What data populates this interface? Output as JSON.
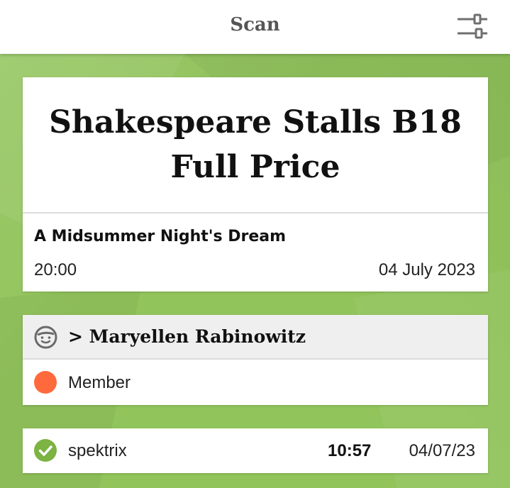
{
  "header": {
    "title": "Scan",
    "settings_icon": "sliders-icon"
  },
  "ticket": {
    "title_line1": "Shakespeare Stalls B18",
    "title_line2": "Full Price",
    "event_name": "A Midsummer Night's Dream",
    "time": "20:00",
    "date": "04 July 2023"
  },
  "customer": {
    "icon": "face-icon",
    "name": "> Maryellen Rabinowitz",
    "membership": {
      "label": "Member",
      "color": "#ff6a3d"
    }
  },
  "scan": {
    "status_icon": "check-circle-icon",
    "status_color": "#7cb342",
    "source": "spektrix",
    "time": "10:57",
    "date": "04/07/23"
  },
  "colors": {
    "background": "#92c45c",
    "card": "#ffffff",
    "header_text": "#555555"
  }
}
